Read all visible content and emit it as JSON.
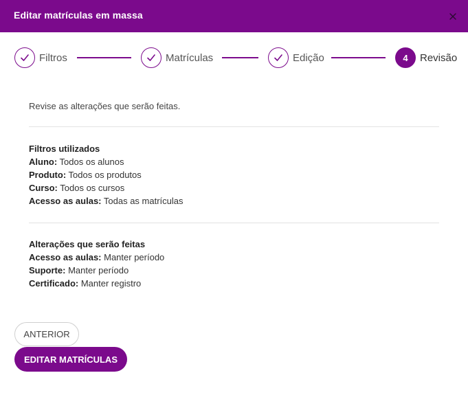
{
  "modal": {
    "title": "Editar matrículas em massa",
    "close_icon": "close-icon"
  },
  "stepper": {
    "steps": [
      {
        "label": "Filtros",
        "status": "done",
        "icon": "check-icon"
      },
      {
        "label": "Matrículas",
        "status": "done",
        "icon": "check-icon"
      },
      {
        "label": "Edição",
        "status": "done",
        "icon": "check-icon"
      },
      {
        "label": "Revisão",
        "status": "active",
        "number": "4"
      }
    ]
  },
  "review": {
    "intro": "Revise as alterações que serão feitas.",
    "filters": {
      "title": "Filtros utilizados",
      "rows": [
        {
          "key": "Aluno:",
          "value": " Todos os alunos"
        },
        {
          "key": "Produto:",
          "value": " Todos os produtos"
        },
        {
          "key": "Curso:",
          "value": " Todos os cursos"
        },
        {
          "key": "Acesso as aulas:",
          "value": " Todas as matrículas"
        }
      ]
    },
    "changes": {
      "title": "Alterações que serão feitas",
      "rows": [
        {
          "key": "Acesso as aulas:",
          "value": " Manter período"
        },
        {
          "key": "Suporte:",
          "value": " Manter período"
        },
        {
          "key": "Certificado:",
          "value": " Manter registro"
        }
      ]
    }
  },
  "actions": {
    "previous_label": "ANTERIOR",
    "submit_label": "EDITAR MATRÍCULAS"
  },
  "colors": {
    "brand": "#7b0a8c",
    "divider": "#e2e2e2"
  }
}
